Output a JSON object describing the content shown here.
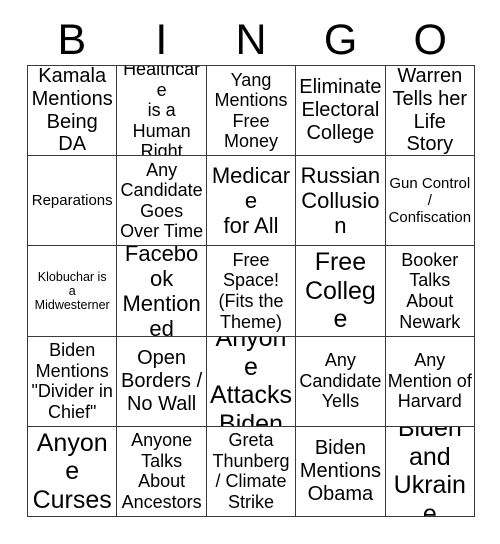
{
  "card": {
    "header_letters": [
      "B",
      "I",
      "N",
      "G",
      "O"
    ],
    "rows": [
      [
        {
          "text": "Kamala\nMentions\nBeing DA",
          "size": "lg"
        },
        {
          "text": "Healthcare\nis a\nHuman\nRight",
          "size": "md"
        },
        {
          "text": "Yang\nMentions\nFree\nMoney",
          "size": "md"
        },
        {
          "text": "Eliminate\nElectoral\nCollege",
          "size": "lg"
        },
        {
          "text": "Warren\nTells her\nLife Story",
          "size": "lg"
        }
      ],
      [
        {
          "text": "Reparations",
          "size": "sm"
        },
        {
          "text": "Any\nCandidate\nGoes\nOver Time",
          "size": "md"
        },
        {
          "text": "Medicare\nfor All",
          "size": "xl"
        },
        {
          "text": "Russian\nCollusion",
          "size": "xl"
        },
        {
          "text": "Gun Control\n/\nConfiscation",
          "size": "sm"
        }
      ],
      [
        {
          "text": "Klobuchar is\na\nMidwesterner",
          "size": "xs"
        },
        {
          "text": "Facebook\nMentioned",
          "size": "xl"
        },
        {
          "text": "Free\nSpace!\n(Fits the\nTheme)",
          "size": "md"
        },
        {
          "text": "Free\nCollege",
          "size": "xxl"
        },
        {
          "text": "Booker\nTalks\nAbout\nNewark",
          "size": "md"
        }
      ],
      [
        {
          "text": "Biden\nMentions\n\"Divider in\nChief\"",
          "size": "md"
        },
        {
          "text": "Open\nBorders /\nNo Wall",
          "size": "lg"
        },
        {
          "text": "Anyone\nAttacks\nBiden",
          "size": "xxl"
        },
        {
          "text": "Any\nCandidate\nYells",
          "size": "md"
        },
        {
          "text": "Any\nMention of\nHarvard",
          "size": "md"
        }
      ],
      [
        {
          "text": "Anyone\nCurses",
          "size": "xxl"
        },
        {
          "text": "Anyone\nTalks\nAbout\nAncestors",
          "size": "md"
        },
        {
          "text": "Greta\nThunberg\n/ Climate\nStrike",
          "size": "md"
        },
        {
          "text": "Biden\nMentions\nObama",
          "size": "lg"
        },
        {
          "text": "Biden\nand\nUkraine",
          "size": "xxl"
        }
      ]
    ]
  },
  "colors": {
    "background": "#ffffff",
    "text": "#000000",
    "grid_line": "#3a3a3a"
  }
}
